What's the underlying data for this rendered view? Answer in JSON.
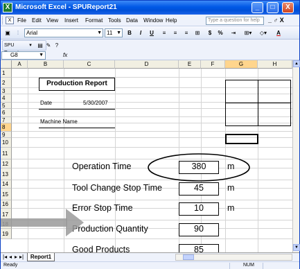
{
  "window": {
    "title": "Microsoft Excel - SPUReport21",
    "app_icon": "X",
    "minimize": "_",
    "maximize": "□",
    "close": "X"
  },
  "menu": {
    "items": [
      "File",
      "Edit",
      "View",
      "Insert",
      "Format",
      "Tools",
      "Data",
      "Window",
      "Help"
    ],
    "ask_placeholder": "Type a question for help",
    "doc_controls": "_ ♂ X"
  },
  "toolbar": {
    "font": "Arial",
    "size": "11",
    "bold": "B",
    "italic": "I",
    "underline": "U",
    "currency": "$",
    "percent": "%",
    "color_a": "A"
  },
  "toolbar2": {
    "label": "SPU Reports"
  },
  "formula": {
    "namebox": "G8",
    "fx": "fx",
    "value": ""
  },
  "columns": [
    "A",
    "B",
    "C",
    "D",
    "E",
    "F",
    "G",
    "H"
  ],
  "selected_column": "G",
  "rows": [
    "1",
    "2",
    "3",
    "4",
    "5",
    "6",
    "7",
    "8",
    "9",
    "10",
    "11",
    "12",
    "13",
    "14",
    "15",
    "16",
    "17",
    "18",
    "19"
  ],
  "selected_row": "8",
  "report": {
    "title": "Production Report",
    "date_label": "Date",
    "date_value": "5/30/2007",
    "machine_label": "Machine Name",
    "op_label": "Operation Time",
    "op_value": "380",
    "op_unit": "m",
    "tool_label": "Tool Change Stop Time",
    "tool_value": "45",
    "tool_unit": "m",
    "error_label": "Error Stop Time",
    "error_value": "10",
    "error_unit": "m",
    "qty_label": "Production Quantity",
    "qty_value": "90",
    "good_label": "Good Products",
    "good_value": "85"
  },
  "sheetbar": {
    "tab": "Report1"
  },
  "status": {
    "ready": "Ready",
    "num": "NUM"
  },
  "colors": {
    "title_blue": "#0058e6",
    "header_bg": "#f1efe2",
    "selected_header": "#ffd58d",
    "pointer": "#9a9a9a"
  }
}
